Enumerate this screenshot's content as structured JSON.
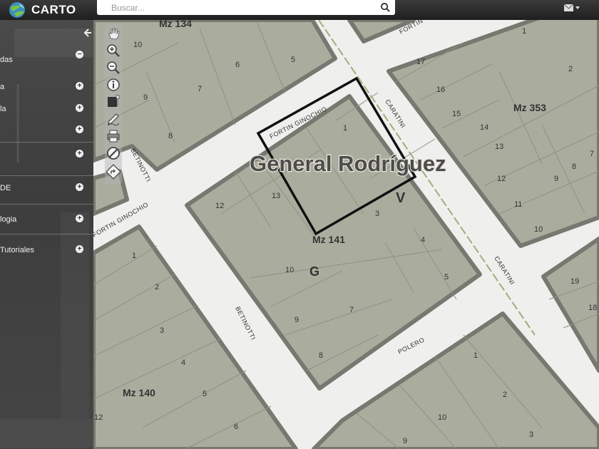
{
  "app": {
    "logo_text": "CARTO",
    "brand_color": "#5bb0d8"
  },
  "search": {
    "placeholder": "Buscar..."
  },
  "header": {
    "mail_icon": "envelope-icon"
  },
  "sidebar": {
    "items": [
      {
        "label": "das"
      },
      {
        "label": "a"
      },
      {
        "label": "la"
      },
      {
        "label": ""
      },
      {
        "label": ""
      },
      {
        "label": "DE"
      },
      {
        "label": "logia"
      },
      {
        "label": "Tutoriales"
      }
    ]
  },
  "tools": [
    "hand-icon",
    "zoom-in-icon",
    "zoom-out-icon",
    "info-icon",
    "measure-icon",
    "pen-icon",
    "print-icon",
    "no-entry-icon",
    "route-icon"
  ],
  "map": {
    "title": "General Rodríguez",
    "streets": [
      "FORTIN GINOCHIO",
      "FORTIN GINOCHIO",
      "BETINOTTI",
      "BETINOTTI",
      "CARATINI",
      "CARATINI",
      "FORTIN",
      "POLERO"
    ],
    "blocks": [
      "Mz 134",
      "Mz 353",
      "Mz 141",
      "Mz 140"
    ],
    "letters": [
      "V",
      "G"
    ],
    "lot_numbers": [
      "10",
      "6",
      "5",
      "9",
      "7",
      "8",
      "17",
      "1",
      "16",
      "2",
      "15",
      "14",
      "13",
      "7",
      "12",
      "9",
      "8",
      "11",
      "10",
      "1",
      "13",
      "12",
      "3",
      "4",
      "5",
      "10",
      "7",
      "9",
      "8",
      "1",
      "2",
      "3",
      "4",
      "5",
      "6",
      "12",
      "1",
      "2",
      "10",
      "9",
      "3",
      "19",
      "18"
    ]
  }
}
